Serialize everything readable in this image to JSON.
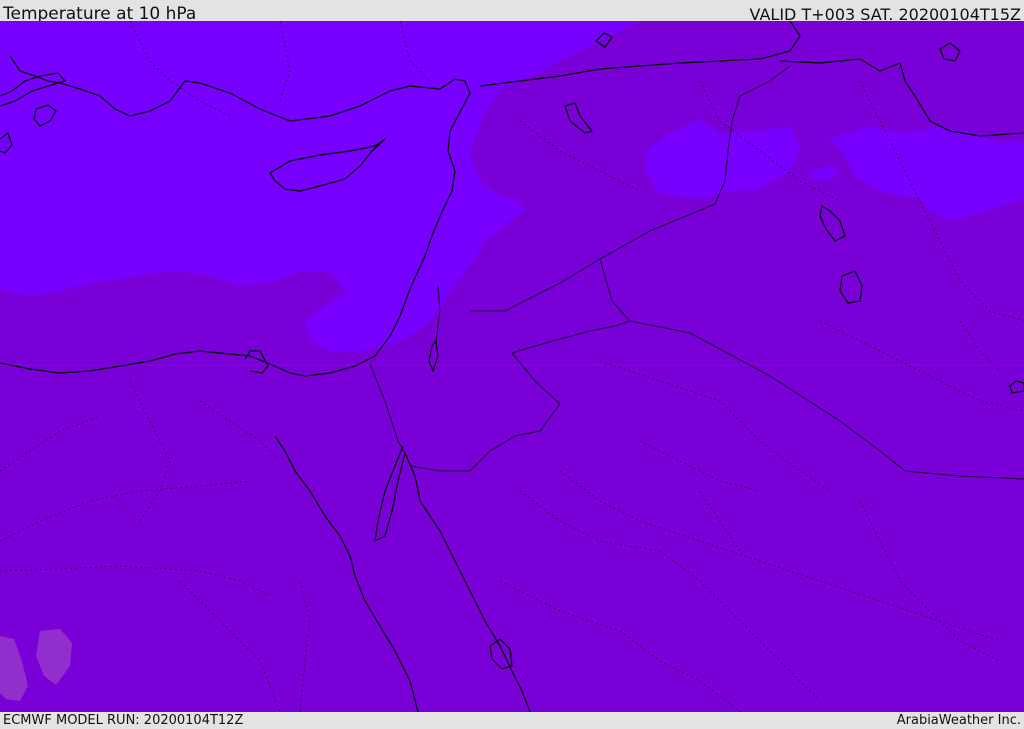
{
  "header": {
    "title": "Temperature at 10 hPa",
    "valid_time": "VALID T+003 SAT. 20200104T15Z"
  },
  "footer": {
    "model_run": "ECMWF MODEL RUN: 20200104T12Z",
    "credit": "ArabiaWeather Inc."
  },
  "map": {
    "colors": {
      "base_fill": "#7a00d8",
      "warmer_fill": "#7700ff",
      "coastline": "#000000",
      "border": "#1a0033",
      "anomaly": "#9a3dc8"
    }
  }
}
